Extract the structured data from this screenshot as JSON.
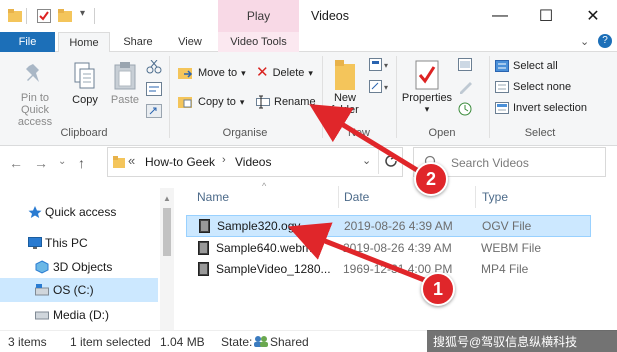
{
  "titlebar": {
    "contextual_tab": "Play",
    "title": "Videos",
    "minimize": "—",
    "maximize": "☐",
    "close": "✕"
  },
  "tabs": [
    "File",
    "Home",
    "Share",
    "View",
    "Video Tools"
  ],
  "ribbon": {
    "clipboard": {
      "pin_line1": "Pin to Quick",
      "pin_line2": "access",
      "copy": "Copy",
      "paste": "Paste",
      "label": "Clipboard"
    },
    "organise": {
      "move_to": "Move to",
      "copy_to": "Copy to",
      "delete": "Delete",
      "rename": "Rename",
      "label": "Organise"
    },
    "new": {
      "new_folder_line1": "New",
      "new_folder_line2": "folder",
      "label": "New"
    },
    "open": {
      "properties": "Properties",
      "label": "Open"
    },
    "select": {
      "select_all": "Select all",
      "select_none": "Select none",
      "invert": "Invert selection",
      "label": "Select"
    }
  },
  "address": {
    "prefix": "«",
    "crumb1": "How-to Geek",
    "crumb2": "Videos",
    "search_placeholder": "Search Videos"
  },
  "nav_pane": [
    {
      "label": "Quick access",
      "icon": "star-icon"
    },
    {
      "label": "This PC",
      "icon": "computer-icon"
    },
    {
      "label": "3D Objects",
      "icon": "cube-icon"
    },
    {
      "label": "OS (C:)",
      "icon": "drive-icon"
    },
    {
      "label": "Media (D:)",
      "icon": "drive-icon"
    }
  ],
  "file_list": {
    "columns": [
      "Name",
      "Date",
      "Type"
    ],
    "rows": [
      {
        "name": "Sample320.ogv",
        "date": "2019-08-26 4:39 AM",
        "type": "OGV File"
      },
      {
        "name": "Sample640.webm",
        "date": "2019-08-26 4:39 AM",
        "type": "WEBM File"
      },
      {
        "name": "SampleVideo_1280...",
        "date": "1969-12-31 4:00 PM",
        "type": "MP4 File"
      }
    ]
  },
  "annotations": {
    "badge1": "1",
    "badge2": "2"
  },
  "status": {
    "items": "3 items",
    "selected": "1 item selected",
    "size": "1.04 MB",
    "state": "State:",
    "state_value": "Shared"
  },
  "watermark": "搜狐号@驾驭信息纵横科技",
  "colors": {
    "accent": "#1c6fb8",
    "selection": "#cce8ff",
    "annotation_red": "#e0262a",
    "play_tab": "#f8d9e6"
  }
}
